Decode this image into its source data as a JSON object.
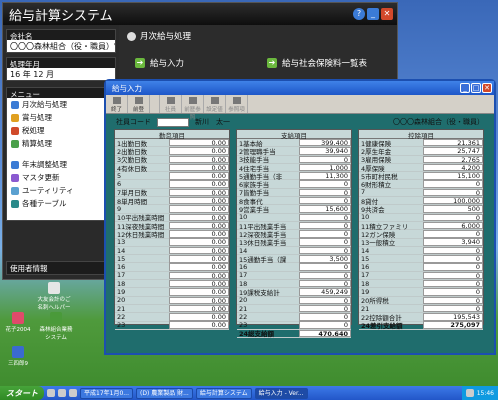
{
  "bg": {
    "title": "給与計算システム",
    "company_label": "会社名",
    "company_value": "〇〇〇森林組合（役・職員）",
    "period_label": "処理年月",
    "period_value": "16 年 12 月",
    "menu_label": "メニュー",
    "menu_items": [
      "月次給与処理",
      "賞与処理",
      "税処理",
      "精算処理",
      "年末調整処理",
      "マスタ更新",
      "ユーティリティ",
      "各種テーブル"
    ],
    "user_info_label": "使用者情報",
    "main_header": "月次給与処理",
    "main_items": [
      "給与入力",
      "給与社会保険料一覧表"
    ]
  },
  "win": {
    "title": "給与入力",
    "toolbar": [
      "終了",
      "前登",
      "",
      "社員",
      "前歴参照",
      "設定値",
      "参照項"
    ],
    "emp_code_label": "社員コード",
    "emp_name": "新川　太一",
    "company": "〇〇〇森林組合（役・職員）",
    "col1": {
      "header": "勤怠項目",
      "rows": [
        {
          "n": "1出勤日数",
          "v": "0.00"
        },
        {
          "n": "2出勤日数",
          "v": "0.00"
        },
        {
          "n": "3欠勤日数",
          "v": "0.00"
        },
        {
          "n": "4有休日数",
          "v": "0.00"
        },
        {
          "n": "5",
          "v": "0.00"
        },
        {
          "n": "6",
          "v": "0.00"
        },
        {
          "n": "7単月日数",
          "v": "0.00"
        },
        {
          "n": "8単月時間",
          "v": "0.00"
        },
        {
          "n": "9",
          "v": "0.00"
        },
        {
          "n": "10平出残業時間",
          "v": "0.00"
        },
        {
          "n": "11深夜残業時間",
          "v": "0.00"
        },
        {
          "n": "12休日残業時間",
          "v": "0.00"
        },
        {
          "n": "13",
          "v": "0.00"
        },
        {
          "n": "14",
          "v": "0.00"
        },
        {
          "n": "15",
          "v": "0.00"
        },
        {
          "n": "16",
          "v": "0.00"
        },
        {
          "n": "17",
          "v": "0.00"
        },
        {
          "n": "18",
          "v": "0.00"
        },
        {
          "n": "19",
          "v": "0.00"
        },
        {
          "n": "20",
          "v": "0.00"
        },
        {
          "n": "21",
          "v": "0.00"
        },
        {
          "n": "22",
          "v": "0.00"
        },
        {
          "n": "23",
          "v": "0.00"
        }
      ]
    },
    "col2": {
      "header": "支給項目",
      "rows": [
        {
          "n": "1基本給",
          "v": "399,400"
        },
        {
          "n": "2管理職手当",
          "v": "39,940"
        },
        {
          "n": "3技能手当",
          "v": "0"
        },
        {
          "n": "4住宅手当",
          "v": "1,000"
        },
        {
          "n": "5通勤手当（非",
          "v": "11,300"
        },
        {
          "n": "6家族手当",
          "v": "0"
        },
        {
          "n": "7皆勤手当",
          "v": "0"
        },
        {
          "n": "8食事代",
          "v": "0"
        },
        {
          "n": "9営業手当",
          "v": "15,600"
        },
        {
          "n": "10",
          "v": "0"
        },
        {
          "n": "11平出残業手当",
          "v": "0"
        },
        {
          "n": "12深夜残業手当",
          "v": "0"
        },
        {
          "n": "13休日残業手当",
          "v": "0"
        },
        {
          "n": "14",
          "v": "0"
        },
        {
          "n": "15通勤手当（課",
          "v": "3,500"
        },
        {
          "n": "16",
          "v": "0"
        },
        {
          "n": "17",
          "v": "0"
        },
        {
          "n": "18",
          "v": "0"
        },
        {
          "n": "19課税支給計",
          "v": "459,249"
        },
        {
          "n": "20",
          "v": "0"
        },
        {
          "n": "21",
          "v": "0"
        },
        {
          "n": "22",
          "v": "0"
        },
        {
          "n": "23",
          "v": "0"
        }
      ],
      "total": {
        "n": "24総支給額",
        "v": "470,640"
      }
    },
    "col3": {
      "header": "控除項目",
      "rows": [
        {
          "n": "1健康保険",
          "v": "21,361"
        },
        {
          "n": "2厚生年金",
          "v": "25,747"
        },
        {
          "n": "3雇用保険",
          "v": "2,765"
        },
        {
          "n": "4厚保険",
          "v": "4,200"
        },
        {
          "n": "5市町村民税",
          "v": "15,100"
        },
        {
          "n": "6財形積立",
          "v": "0"
        },
        {
          "n": "7",
          "v": "0"
        },
        {
          "n": "8貸付",
          "v": "100,000"
        },
        {
          "n": "9共済会",
          "v": "500"
        },
        {
          "n": "10",
          "v": "0"
        },
        {
          "n": "11積立ファミリ",
          "v": "6,000"
        },
        {
          "n": "12ガン保険",
          "v": "0"
        },
        {
          "n": "13一般積立",
          "v": "3,940"
        },
        {
          "n": "14",
          "v": "0"
        },
        {
          "n": "15",
          "v": "0"
        },
        {
          "n": "16",
          "v": "0"
        },
        {
          "n": "17",
          "v": "0"
        },
        {
          "n": "18",
          "v": "0"
        },
        {
          "n": "19",
          "v": "0"
        },
        {
          "n": "20所得税",
          "v": "0"
        },
        {
          "n": "21",
          "v": "0"
        },
        {
          "n": "22控除額合計",
          "v": "195,543"
        }
      ],
      "total": {
        "n": "24差引支給額",
        "v": "275,097"
      }
    }
  },
  "desktop": {
    "icons": [
      "大友会計のご 名刺ヘルパー",
      "花子2004",
      "森林組合業務 システム",
      "三四郎9"
    ]
  },
  "taskbar": {
    "start": "スタート",
    "tasks": [
      "平成17年1月0...",
      "(D) 農業製品 財...",
      "給与計算システム",
      "給与入力 - Ver..."
    ],
    "clock": "15:46"
  }
}
